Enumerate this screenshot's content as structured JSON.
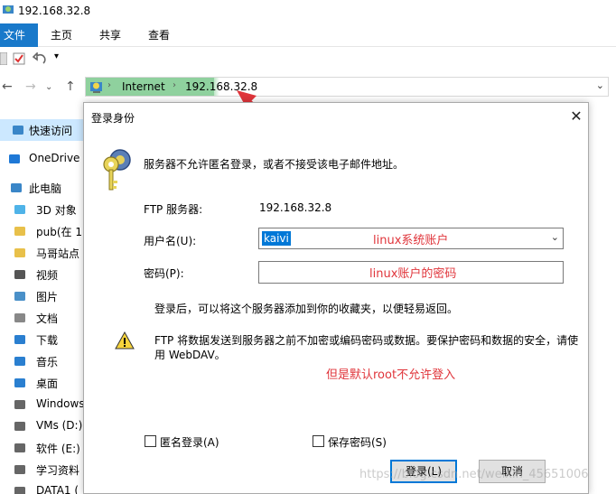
{
  "window": {
    "title": "192.168.32.8"
  },
  "ribbon": {
    "tabs": [
      "文件",
      "主页",
      "共享",
      "查看"
    ]
  },
  "address": {
    "path": [
      "Internet",
      "192.168.32.8"
    ]
  },
  "sidebar": {
    "items": [
      {
        "label": "快速访问",
        "icon": "pin-icon"
      },
      {
        "label": "OneDrive",
        "icon": "cloud-icon"
      },
      {
        "label": "此电脑",
        "icon": "computer-icon"
      },
      {
        "label": "3D 对象",
        "icon": "cube-icon"
      },
      {
        "label": "pub(在 1",
        "icon": "folder-icon"
      },
      {
        "label": "马哥站点",
        "icon": "folder-icon"
      },
      {
        "label": "视频",
        "icon": "video-icon"
      },
      {
        "label": "图片",
        "icon": "picture-icon"
      },
      {
        "label": "文档",
        "icon": "document-icon"
      },
      {
        "label": "下载",
        "icon": "download-icon"
      },
      {
        "label": "音乐",
        "icon": "music-icon"
      },
      {
        "label": "桌面",
        "icon": "desktop-icon"
      },
      {
        "label": "Windows",
        "icon": "drive-icon"
      },
      {
        "label": "VMs (D:)",
        "icon": "drive-icon"
      },
      {
        "label": "软件 (E:)",
        "icon": "drive-icon"
      },
      {
        "label": "学习资料",
        "icon": "drive-icon"
      },
      {
        "label": "DATA1 (",
        "icon": "drive-icon"
      }
    ]
  },
  "dialog": {
    "title": "登录身份",
    "message": "服务器不允许匿名登录，或者不接受该电子邮件地址。",
    "ftp_server_label": "FTP 服务器:",
    "ftp_server_value": "192.168.32.8",
    "username_label": "用户名(U):",
    "username_value": "kaivi",
    "password_label": "密码(P):",
    "favorites_message": "登录后，可以将这个服务器添加到你的收藏夹，以便轻易返回。",
    "warning_line1": "FTP 将数据发送到服务器之前不加密或编码密码或数据。要保护密码和数据的安全，请使",
    "warning_line2": "用 WebDAV。",
    "anonymous_label": "匿名登录(A)",
    "save_password_label": "保存密码(S)",
    "login_button": "登录(L)",
    "cancel_button": "取消"
  },
  "annotations": {
    "username_note": "linux系统账户",
    "password_note": "linux账户的密码",
    "root_note": "但是默认root不允许登入",
    "arrow_color": "#e0353b"
  },
  "watermark": "https://blog.csdn.net/weixin_45651006"
}
